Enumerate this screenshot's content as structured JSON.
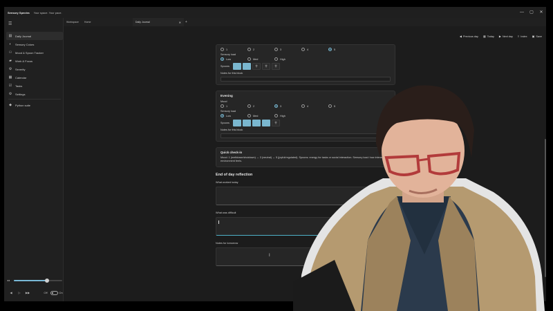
{
  "window": {
    "app_name": "Sensory Spectra",
    "tagline": "Your space. Your pace.",
    "controls": {
      "minimize": "—",
      "maximize": "▢",
      "close": "✕"
    }
  },
  "sidebar": {
    "items": [
      {
        "label": "Daily Journal",
        "icon": "journal-icon",
        "active": true
      },
      {
        "label": "Sensory Colors",
        "icon": "palette-icon"
      },
      {
        "label": "Mood & Spoon Tracker",
        "icon": "spoon-icon"
      },
      {
        "label": "Work & Focus",
        "icon": "folder-icon"
      },
      {
        "label": "Severity",
        "icon": "gear-icon"
      },
      {
        "label": "Calendar",
        "icon": "calendar-icon"
      },
      {
        "label": "Tasks",
        "icon": "checklist-icon"
      },
      {
        "label": "Settings",
        "icon": "settings-icon"
      },
      {
        "label": "Python suite",
        "icon": "python-icon"
      }
    ],
    "media": {
      "volume_progress": 0.68,
      "prev": "◀",
      "play": "▷",
      "next": "▶▶",
      "off": "Off",
      "on": "On"
    }
  },
  "tabs": [
    {
      "label": "Workspace"
    },
    {
      "label": "Home"
    },
    {
      "label": "Daily Journal",
      "active": true
    }
  ],
  "toolbar": {
    "previous_day": "Previous day",
    "today": "Today",
    "next_day": "Next day",
    "index": "Index",
    "save": "Save"
  },
  "afternoon_block": {
    "mood_title": "Mood",
    "mood_options": [
      "1",
      "2",
      "3",
      "4",
      "5"
    ],
    "mood_selected": 5,
    "sensory_label": "Sensory load",
    "sensory_options": [
      "Low",
      "Med",
      "High"
    ],
    "sensory_selected": "Low",
    "spoons_label": "Spoons",
    "spoons_filled": 2,
    "spoons_total": 5,
    "notes_label": "Notes for this block"
  },
  "evening_block": {
    "title": "Evening",
    "mood_label": "Mood",
    "mood_options": [
      "1",
      "2",
      "3",
      "4",
      "5"
    ],
    "mood_selected": 3,
    "sensory_label": "Sensory load",
    "sensory_options": [
      "Low",
      "Med",
      "High"
    ],
    "sensory_selected": "Low",
    "spoons_label": "Spoons",
    "spoons_filled": 4,
    "spoons_total": 5,
    "notes_label": "Notes for this block"
  },
  "quick_checkin": {
    "title": "Quick check-in",
    "text": "Mood: 1 (meltdown/shutdown) → 3 (neutral) → 5 (joyful/regulated). Spoons: energy for tasks or social interaction. Sensory load: how intense the environment feels."
  },
  "reflection": {
    "title": "End of day reflection",
    "worked_label": "What worked today",
    "difficult_label": "What was difficult",
    "tomorrow_label": "Notes for tomorrow"
  },
  "colors": {
    "accent": "#7ab7cf",
    "background": "#1c1c1c",
    "card": "#262626"
  }
}
